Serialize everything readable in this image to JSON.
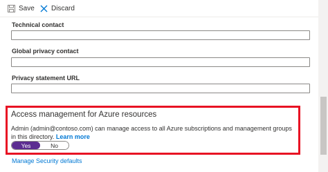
{
  "toolbar": {
    "save_label": "Save",
    "discard_label": "Discard"
  },
  "fields": {
    "technical_contact": {
      "label": "Technical contact",
      "value": ""
    },
    "global_privacy_contact": {
      "label": "Global privacy contact",
      "value": ""
    },
    "privacy_statement_url": {
      "label": "Privacy statement URL",
      "value": ""
    }
  },
  "access": {
    "title": "Access management for Azure resources",
    "description": "Admin (admin@contoso.com) can manage access to all Azure subscriptions and management groups in this directory.",
    "learn_more": "Learn more",
    "toggle": {
      "yes_label": "Yes",
      "no_label": "No",
      "selected": "Yes"
    }
  },
  "manage_security_defaults": "Manage Security defaults",
  "colors": {
    "accent_link": "#0078d4",
    "toggle_on": "#5c2d91",
    "highlight_border": "#e81123"
  },
  "icons": {
    "save": "save-icon",
    "discard": "close-icon"
  }
}
